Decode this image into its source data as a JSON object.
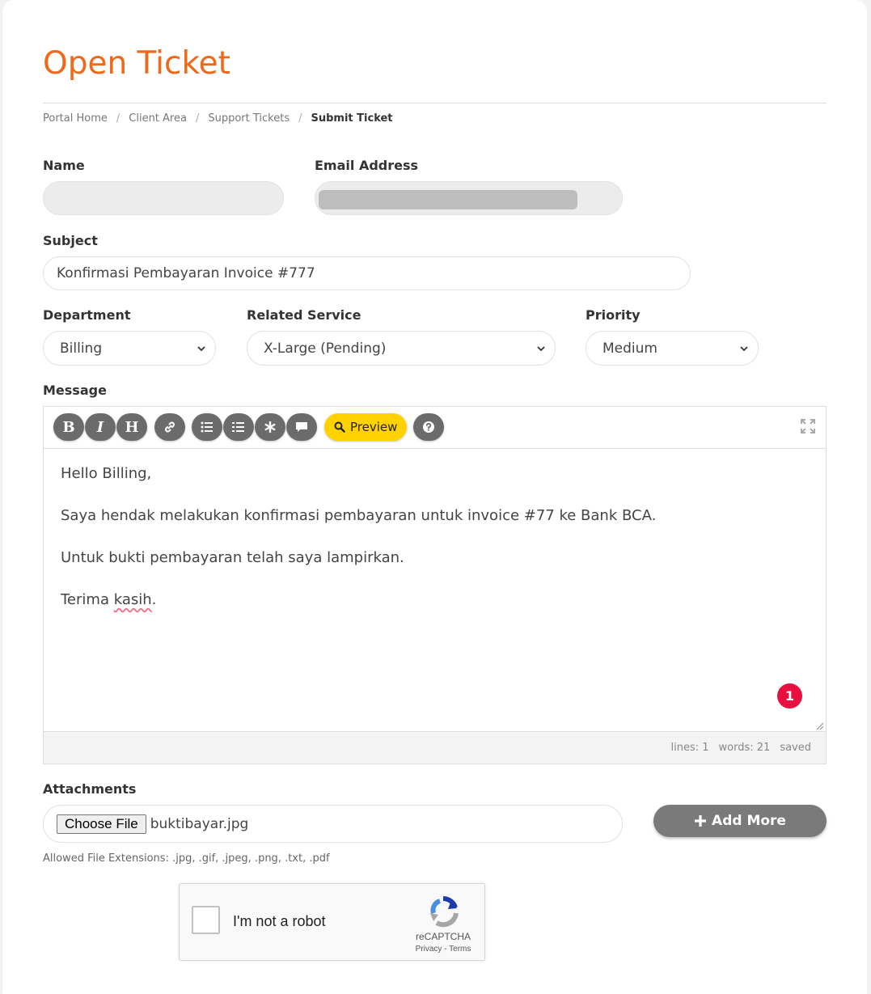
{
  "page": {
    "title": "Open Ticket"
  },
  "breadcrumb": {
    "items": [
      "Portal Home",
      "Client Area",
      "Support Tickets"
    ],
    "separator": "/",
    "active": "Submit Ticket"
  },
  "form": {
    "name_label": "Name",
    "email_label": "Email Address",
    "subject_label": "Subject",
    "subject_value": "Konfirmasi Pembayaran Invoice #777",
    "department_label": "Department",
    "department_value": "Billing",
    "service_label": "Related Service",
    "service_value": "X-Large (Pending)",
    "priority_label": "Priority",
    "priority_value": "Medium",
    "message_label": "Message"
  },
  "editor": {
    "toolbar": {
      "bold": "B",
      "italic": "I",
      "heading": "H",
      "preview_label": "Preview"
    },
    "lines": [
      "Hello Billing,",
      "Saya hendak melakukan konfirmasi pembayaran untuk invoice #77 ke Bank BCA.",
      "Untuk bukti pembayaran telah saya lampirkan."
    ],
    "closing_word": "Terima",
    "closing_misspelled": "kasih",
    "closing_end": ".",
    "badge_count": "1",
    "status": {
      "lines": "lines: 1",
      "words": "words: 21",
      "saved": "saved"
    }
  },
  "attachments": {
    "label": "Attachments",
    "choose_label": "Choose File",
    "file_name": "buktibayar.jpg",
    "add_more_label": "Add More",
    "allowed_text": "Allowed File Extensions: .jpg, .gif, .jpeg, .png, .txt, .pdf"
  },
  "captcha": {
    "label": "I'm not a robot",
    "brand": "reCAPTCHA",
    "privacy": "Privacy",
    "dash": " - ",
    "terms": "Terms"
  },
  "colors": {
    "title": "#f0691a",
    "preview_button": "#ffd200",
    "badge": "#e8103e",
    "toolbar_button": "#6b6b6b",
    "add_more": "#7a7a7a"
  }
}
